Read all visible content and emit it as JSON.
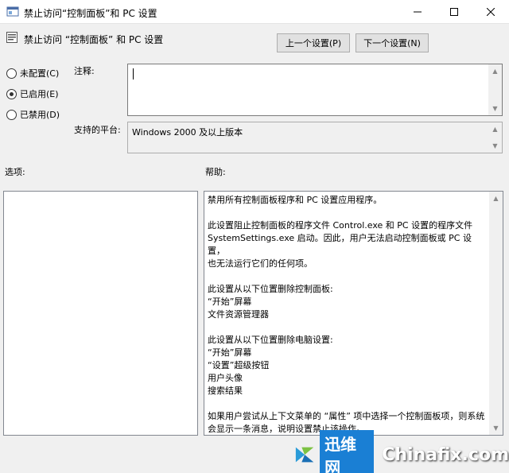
{
  "window": {
    "title": "禁止访问“控制面板”和 PC 设置",
    "minimize_icon": "minimize-icon",
    "maximize_icon": "maximize-icon",
    "close_icon": "close-icon"
  },
  "header": {
    "policy_name": "禁止访问 “控制面板” 和 PC 设置",
    "prev_button": "上一个设置(P)",
    "next_button": "下一个设置(N)"
  },
  "state": {
    "options": [
      {
        "label": "未配置(C)",
        "checked": false
      },
      {
        "label": "已启用(E)",
        "checked": true
      },
      {
        "label": "已禁用(D)",
        "checked": false
      }
    ]
  },
  "comment": {
    "label": "注释:",
    "value": ""
  },
  "platform": {
    "label": "支持的平台:",
    "value": "Windows 2000 及以上版本"
  },
  "options_section": {
    "label": "选项:"
  },
  "help_section": {
    "label": "帮助:",
    "paragraphs": [
      [
        "禁用所有控制面板程序和 PC 设置应用程序。"
      ],
      [
        "此设置阻止控制面板的程序文件 Control.exe 和 PC 设置的程序文件",
        "SystemSettings.exe 启动。因此，用户无法启动控制面板或 PC 设置，",
        "也无法运行它们的任何项。"
      ],
      [
        "此设置从以下位置删除控制面板:",
        "“开始”屏幕",
        "文件资源管理器"
      ],
      [
        "此设置从以下位置删除电脑设置:",
        "“开始”屏幕",
        "“设置”超级按钮",
        "用户头像",
        "搜索结果"
      ],
      [
        "如果用户尝试从上下文菜单的 “属性” 项中选择一个控制面板项，则系统",
        "会显示一条消息，说明设置禁止该操作。"
      ]
    ]
  },
  "watermark": {
    "cn": "迅维网",
    "en": "Chinafix.com"
  }
}
